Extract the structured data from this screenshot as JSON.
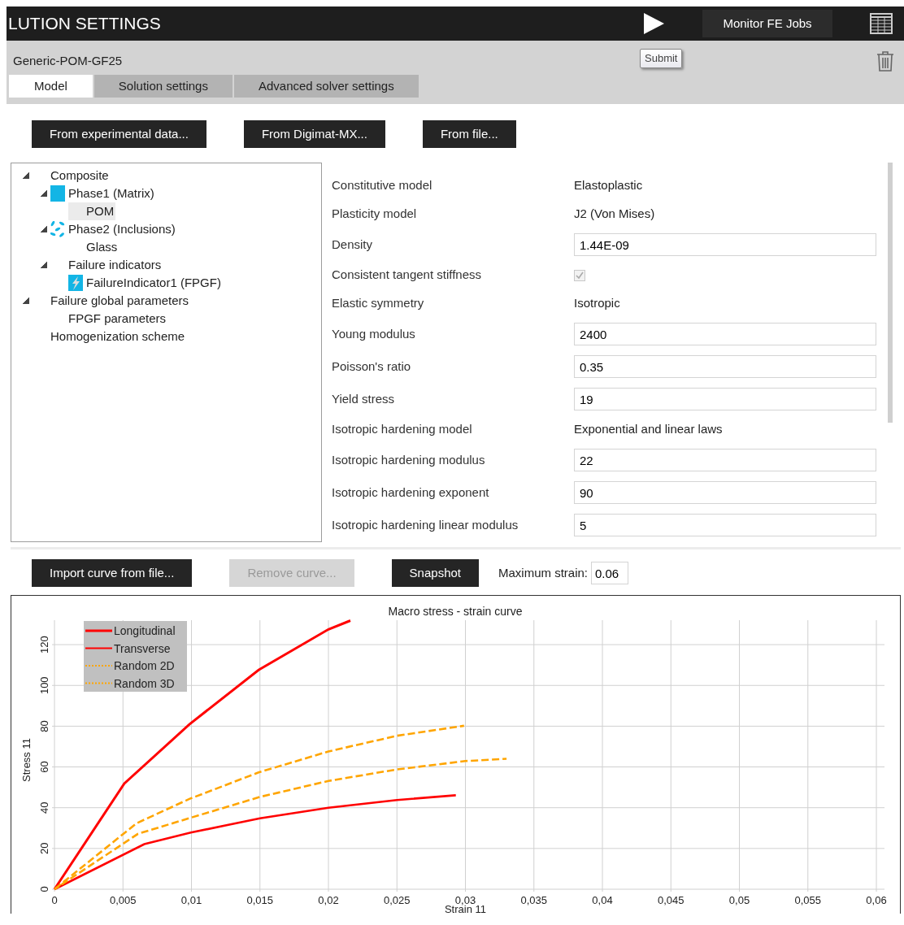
{
  "header": {
    "title": "LUTION SETTINGS",
    "monitor_button": "Monitor FE Jobs",
    "tooltip": "Submit"
  },
  "material_name": "Generic-POM-GF25",
  "tabs": [
    {
      "label": "Model",
      "selected": true
    },
    {
      "label": "Solution settings",
      "selected": false
    },
    {
      "label": "Advanced solver settings",
      "selected": false
    }
  ],
  "model_buttons": [
    {
      "label": "From experimental data...",
      "disabled": false
    },
    {
      "label": "From Digimat-MX...",
      "disabled": false
    },
    {
      "label": "From file...",
      "disabled": false
    }
  ],
  "tree": [
    {
      "label": "Composite",
      "expanded": true,
      "selected": false,
      "children": [
        {
          "label": "Phase1 (Matrix)",
          "kind": "matrix",
          "expanded": true,
          "selected": false,
          "children": [
            {
              "label": "POM",
              "selected": true
            }
          ]
        },
        {
          "label": "Phase2 (Inclusions)",
          "kind": "inclusions",
          "expanded": true,
          "selected": false,
          "children": [
            {
              "label": "Glass",
              "selected": false
            }
          ]
        },
        {
          "label": "Failure indicators",
          "expanded": true,
          "selected": false,
          "children": [
            {
              "label": "FailureIndicator1 (FPGF)",
              "kind": "failure",
              "selected": false
            }
          ]
        }
      ]
    },
    {
      "label": "Failure global parameters",
      "expanded": true,
      "selected": false,
      "children": [
        {
          "label": "FPGF parameters",
          "selected": false
        }
      ]
    },
    {
      "label": "Homogenization scheme",
      "selected": false
    }
  ],
  "properties": [
    {
      "label": "Constitutive model",
      "kind": "text",
      "value": "Elastoplastic"
    },
    {
      "label": "Plasticity model",
      "kind": "text",
      "value": "J2 (Von Mises)"
    },
    {
      "label": "Density",
      "kind": "input",
      "value": "1.44E-09"
    },
    {
      "label": "Consistent tangent stiffness",
      "kind": "checkbox",
      "checked": true,
      "disabled": true
    },
    {
      "label": "Elastic symmetry",
      "kind": "text",
      "value": "Isotropic"
    },
    {
      "label": "Young modulus",
      "kind": "input",
      "value": "2400"
    },
    {
      "label": "Poisson's ratio",
      "kind": "input",
      "value": "0.35"
    },
    {
      "label": "Yield stress",
      "kind": "input",
      "value": "19"
    },
    {
      "label": "Isotropic hardening model",
      "kind": "text",
      "value": "Exponential and linear laws"
    },
    {
      "label": "Isotropic hardening modulus",
      "kind": "input",
      "value": "22"
    },
    {
      "label": "Isotropic hardening exponent",
      "kind": "input",
      "value": "90"
    },
    {
      "label": "Isotropic hardening linear modulus",
      "kind": "input",
      "value": "5"
    }
  ],
  "curve_buttons": [
    {
      "label": "Import curve from file...",
      "disabled": false
    },
    {
      "label": "Remove curve...",
      "disabled": true
    },
    {
      "label": "Snapshot",
      "disabled": false
    }
  ],
  "max_strain": {
    "label": "Maximum strain:",
    "value": "0.06"
  },
  "chart_data": {
    "type": "line",
    "title": "Macro stress - strain curve",
    "xlabel": "Strain 11",
    "ylabel": "Stress 11",
    "xlim": [
      0,
      0.06
    ],
    "ylim": [
      0,
      132
    ],
    "grid": true,
    "legend": true,
    "xticks": [
      {
        "value": 0,
        "label": "0"
      },
      {
        "value": 0.005,
        "label": "0,005"
      },
      {
        "value": 0.01,
        "label": "0,01"
      },
      {
        "value": 0.015,
        "label": "0,015"
      },
      {
        "value": 0.02,
        "label": "0,02"
      },
      {
        "value": 0.025,
        "label": "0,025"
      },
      {
        "value": 0.03,
        "label": "0,03"
      },
      {
        "value": 0.035,
        "label": "0,035"
      },
      {
        "value": 0.04,
        "label": "0,04"
      },
      {
        "value": 0.045,
        "label": "0,045"
      },
      {
        "value": 0.05,
        "label": "0,05"
      },
      {
        "value": 0.055,
        "label": "0,055"
      },
      {
        "value": 0.06,
        "label": "0,06"
      }
    ],
    "yticks": [
      0,
      20,
      40,
      60,
      80,
      100,
      120
    ],
    "series": [
      {
        "name": "Longitudinal",
        "color": "#ff0000",
        "line_style": "solid",
        "x": [
          0,
          0.0051,
          0.00985,
          0.0149,
          0.02,
          0.0216
        ],
        "values": [
          0,
          51.9,
          80.9,
          107.6,
          127.5,
          131.8
        ]
      },
      {
        "name": "Transverse",
        "color": "#ff0000",
        "line_style": "solid",
        "x": [
          0,
          0.00656,
          0.00995,
          0.015,
          0.02,
          0.025,
          0.0293
        ],
        "values": [
          0,
          22.1,
          27.8,
          34.8,
          40,
          43.8,
          46.1
        ]
      },
      {
        "name": "Random 2D",
        "color": "#ffa500",
        "line_style": "dashed",
        "x": [
          0,
          0.006,
          0.00985,
          0.0149,
          0.02,
          0.025,
          0.0299
        ],
        "values": [
          0,
          32.4,
          44.3,
          57.3,
          67.6,
          75.3,
          80.2
        ]
      },
      {
        "name": "Random 3D",
        "color": "#ffa500",
        "line_style": "dashed",
        "x": [
          0,
          0.0061,
          0.00995,
          0.015,
          0.02,
          0.025,
          0.03,
          0.033
        ],
        "values": [
          0,
          27.2,
          35.1,
          45.3,
          53.1,
          58.8,
          62.9,
          64
        ]
      }
    ]
  }
}
